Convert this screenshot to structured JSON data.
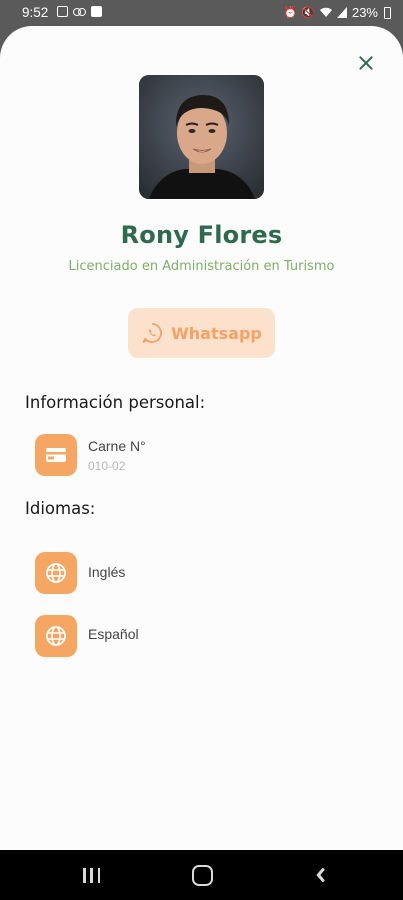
{
  "status_bar": {
    "time": "9:52",
    "battery": "23%"
  },
  "profile": {
    "name": "Rony Flores",
    "title": "Licenciado en Administración en Turismo"
  },
  "actions": {
    "whatsapp_label": "Whatsapp"
  },
  "personal_info": {
    "heading": "Información personal:",
    "items": [
      {
        "label": "Carne N°",
        "value": "010-02",
        "icon": "id-card-icon"
      }
    ]
  },
  "languages": {
    "heading": "Idiomas:",
    "items": [
      {
        "label": "Inglés",
        "icon": "globe-icon"
      },
      {
        "label": "Español",
        "icon": "globe-icon"
      }
    ]
  },
  "colors": {
    "primary_green": "#2e6b4e",
    "subtitle_green": "#7fae6a",
    "accent_orange": "#f5a663",
    "whatsapp_bg": "#fce1cc"
  }
}
